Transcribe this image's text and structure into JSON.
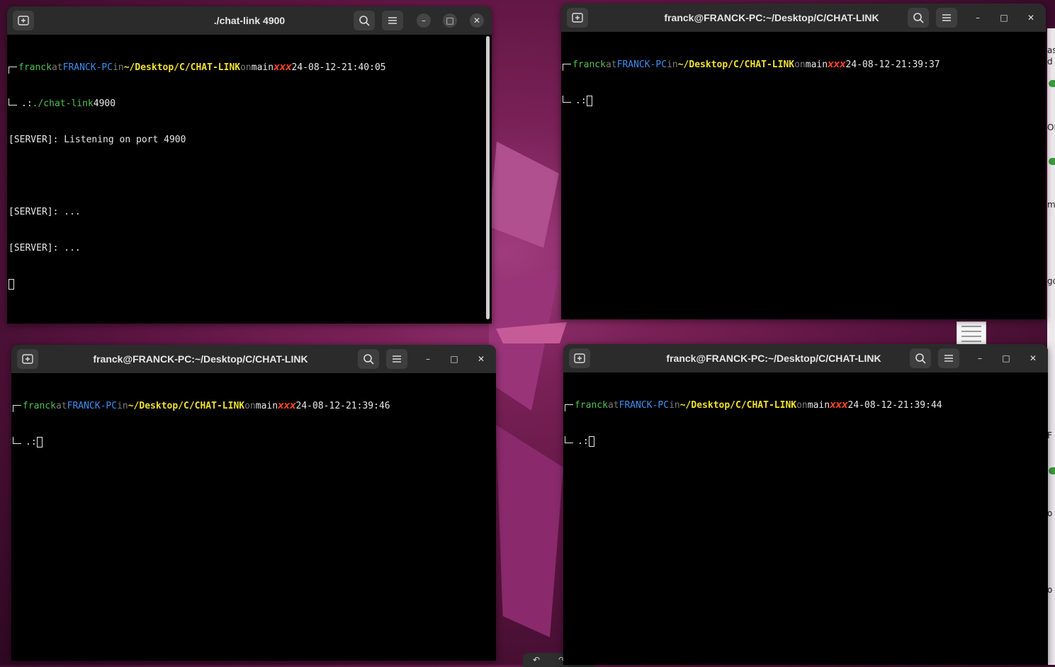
{
  "windows": [
    {
      "title": "./chat-link 4900",
      "prompt": {
        "user": "franck",
        "at": "at",
        "host": "FRANCK-PC",
        "in": "in",
        "path": "~/Desktop/C/CHAT-LINK",
        "on": "on",
        "branch": "main",
        "status": "XXX",
        "date": "24-08-12",
        "dash": "-",
        "time": "21:40:05"
      },
      "prompt_symbol": ".:",
      "command": "./chat-link",
      "command_arg": "4900",
      "output": [
        "[SERVER]: Listening on port 4900",
        "",
        "[SERVER]: ...",
        "[SERVER]: ..."
      ]
    },
    {
      "title": "franck@FRANCK-PC:~/Desktop/C/CHAT-LINK",
      "prompt": {
        "user": "franck",
        "at": "at",
        "host": "FRANCK-PC",
        "in": "in",
        "path": "~/Desktop/C/CHAT-LINK",
        "on": "on",
        "branch": "main",
        "status": "XXX",
        "date": "24-08-12",
        "dash": "-",
        "time": "21:39:37"
      },
      "prompt_symbol": ".:"
    },
    {
      "title": "franck@FRANCK-PC:~/Desktop/C/CHAT-LINK",
      "prompt": {
        "user": "franck",
        "at": "at",
        "host": "FRANCK-PC",
        "in": "in",
        "path": "~/Desktop/C/CHAT-LINK",
        "on": "on",
        "branch": "main",
        "status": "XXX",
        "date": "24-08-12",
        "dash": "-",
        "time": "21:39:46"
      },
      "prompt_symbol": ".:"
    },
    {
      "title": "franck@FRANCK-PC:~/Desktop/C/CHAT-LINK",
      "prompt": {
        "user": "franck",
        "at": "at",
        "host": "FRANCK-PC",
        "in": "in",
        "path": "~/Desktop/C/CHAT-LINK",
        "on": "on",
        "branch": "main",
        "status": "XXX",
        "date": "24-08-12",
        "dash": "-",
        "time": "21:39:44"
      },
      "prompt_symbol": ".:"
    }
  ],
  "icons": {
    "new_tab": "new-tab-icon",
    "search": "search-icon",
    "menu": "hamburger-menu-icon",
    "minimize": "minimize-icon",
    "maximize": "maximize-icon",
    "close": "close-icon"
  },
  "background_strip_text": [
    "as",
    "d",
    "OF",
    "ma",
    "go",
    "F",
    "o",
    "o"
  ],
  "colors": {
    "user": "#4fc14f",
    "host": "#3d8ef0",
    "path": "#f0e030",
    "status": "#ff4422",
    "titlebar": "#2b2b2b",
    "terminal_bg": "#000000"
  }
}
